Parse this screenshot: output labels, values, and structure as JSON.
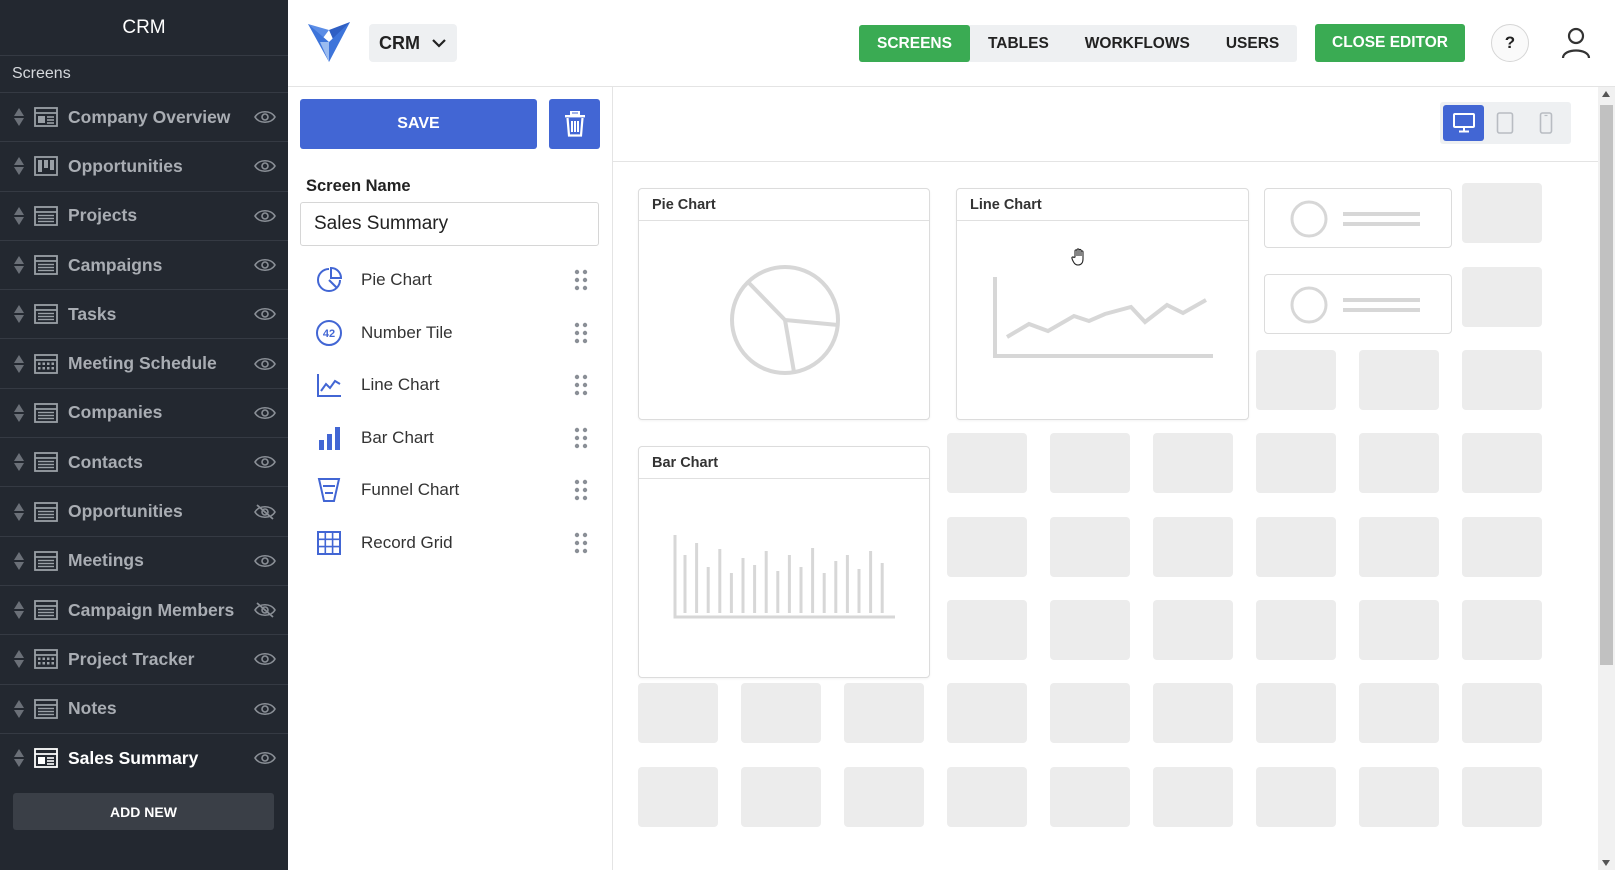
{
  "sidebar": {
    "title": "CRM",
    "section": "Screens",
    "items": [
      {
        "label": "Company Overview",
        "icon": "dashboard-screen-icon",
        "visible": true
      },
      {
        "label": "Opportunities",
        "icon": "kanban-screen-icon",
        "visible": true
      },
      {
        "label": "Projects",
        "icon": "table-screen-icon",
        "visible": true
      },
      {
        "label": "Campaigns",
        "icon": "table-screen-icon",
        "visible": true
      },
      {
        "label": "Tasks",
        "icon": "table-screen-icon",
        "visible": true
      },
      {
        "label": "Meeting Schedule",
        "icon": "calendar-screen-icon",
        "visible": true
      },
      {
        "label": "Companies",
        "icon": "table-screen-icon",
        "visible": true
      },
      {
        "label": "Contacts",
        "icon": "table-screen-icon",
        "visible": true
      },
      {
        "label": "Opportunities",
        "icon": "table-screen-icon",
        "visible": false
      },
      {
        "label": "Meetings",
        "icon": "table-screen-icon",
        "visible": true
      },
      {
        "label": "Campaign Members",
        "icon": "table-screen-icon",
        "visible": false
      },
      {
        "label": "Project Tracker",
        "icon": "calendar-screen-icon",
        "visible": true
      },
      {
        "label": "Notes",
        "icon": "table-screen-icon",
        "visible": true
      },
      {
        "label": "Sales Summary",
        "icon": "dashboard-screen-icon",
        "visible": true,
        "active": true
      }
    ],
    "add_new": "ADD NEW"
  },
  "topbar": {
    "app_name": "CRM",
    "tabs": [
      {
        "label": "SCREENS",
        "active": true
      },
      {
        "label": "TABLES",
        "active": false
      },
      {
        "label": "WORKFLOWS",
        "active": false
      },
      {
        "label": "USERS",
        "active": false
      }
    ],
    "close_editor": "CLOSE EDITOR",
    "help": "?"
  },
  "panel": {
    "save": "SAVE",
    "screen_name_label": "Screen Name",
    "screen_name_value": "Sales Summary",
    "widgets": [
      {
        "label": "Pie Chart",
        "icon": "pie-chart-icon"
      },
      {
        "label": "Number Tile",
        "icon": "number-tile-icon",
        "icon_text": "42"
      },
      {
        "label": "Line Chart",
        "icon": "line-chart-icon"
      },
      {
        "label": "Bar Chart",
        "icon": "bar-chart-icon"
      },
      {
        "label": "Funnel Chart",
        "icon": "funnel-chart-icon"
      },
      {
        "label": "Record Grid",
        "icon": "record-grid-icon"
      }
    ]
  },
  "canvas": {
    "device_modes": [
      "desktop",
      "tablet",
      "mobile"
    ],
    "active_device": "desktop",
    "cards": {
      "pie": "Pie Chart",
      "line": "Line Chart",
      "bar": "Bar Chart"
    }
  },
  "colors": {
    "sidebar_bg": "#232830",
    "primary_blue": "#4266d4",
    "accent_green": "#3aab53"
  }
}
